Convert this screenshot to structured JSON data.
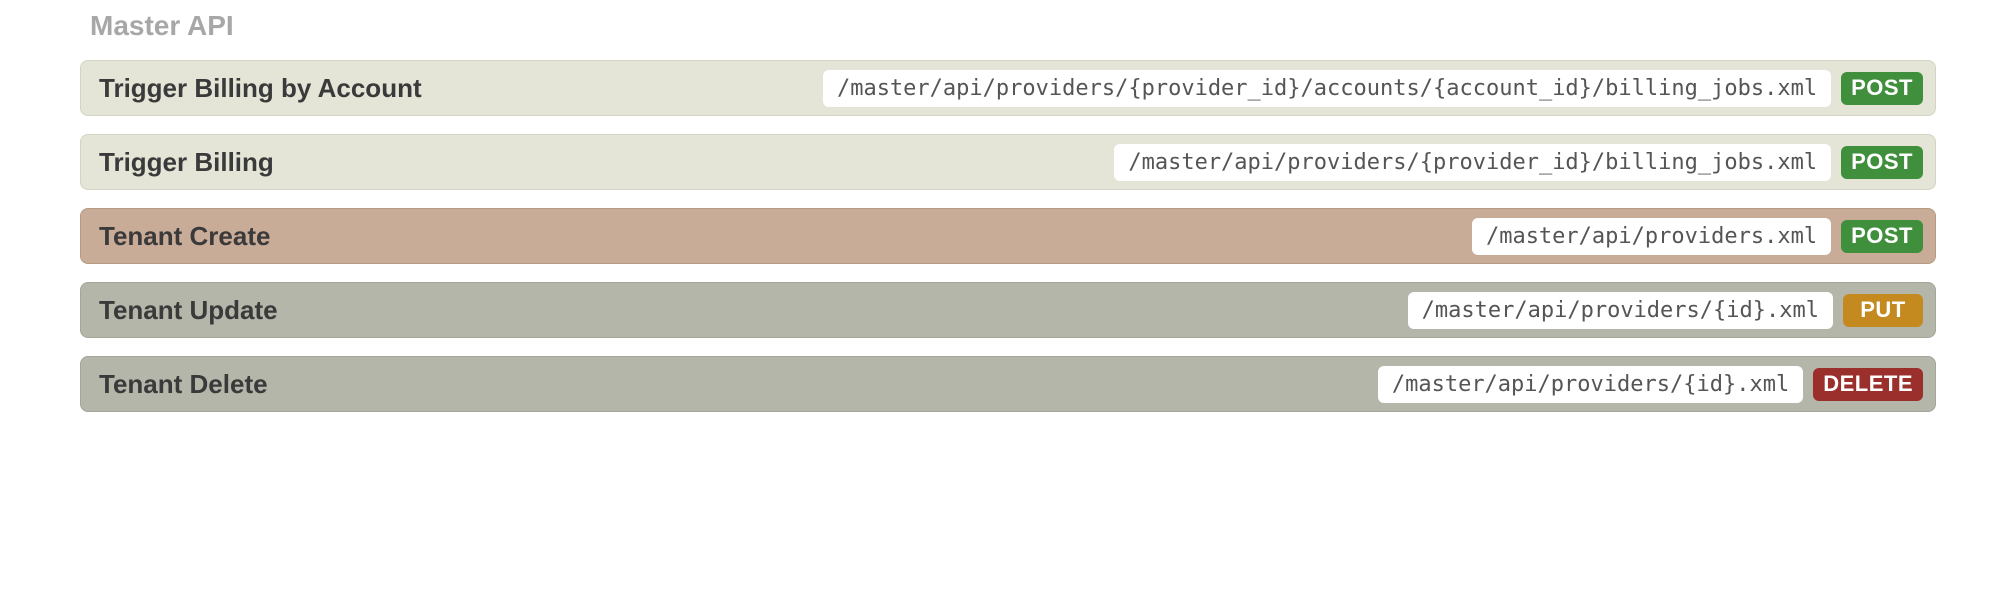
{
  "section_title": "Master API",
  "colors": {
    "cream": "#e4e5d7",
    "tan": "#c9ac97",
    "grey": "#b5b6aa",
    "post": "#3f8f3d",
    "put": "#c48a1f",
    "delete": "#9b2f2b"
  },
  "operations": [
    {
      "name": "Trigger Billing by Account",
      "path": "/master/api/providers/{provider_id}/accounts/{account_id}/billing_jobs.xml",
      "method": "POST",
      "variant": "cream"
    },
    {
      "name": "Trigger Billing",
      "path": "/master/api/providers/{provider_id}/billing_jobs.xml",
      "method": "POST",
      "variant": "cream"
    },
    {
      "name": "Tenant Create",
      "path": "/master/api/providers.xml",
      "method": "POST",
      "variant": "tan"
    },
    {
      "name": "Tenant Update",
      "path": "/master/api/providers/{id}.xml",
      "method": "PUT",
      "variant": "grey"
    },
    {
      "name": "Tenant Delete",
      "path": "/master/api/providers/{id}.xml",
      "method": "DELETE",
      "variant": "grey"
    }
  ]
}
